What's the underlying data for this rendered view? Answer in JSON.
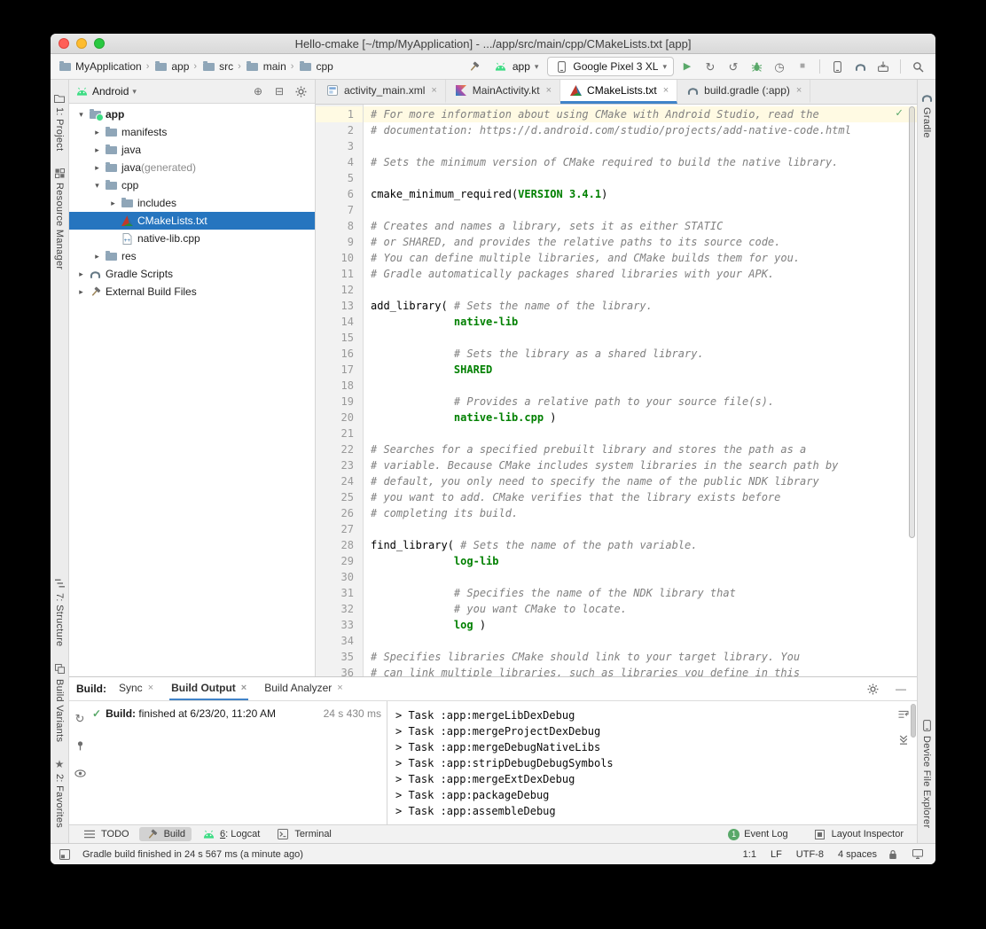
{
  "window": {
    "title": "Hello-cmake [~/tmp/MyApplication] - .../app/src/main/cpp/CMakeLists.txt [app]"
  },
  "colors": {
    "selection": "#2675bf",
    "keyword": "#008000",
    "comment": "#808080",
    "run_green": "#59a869",
    "caret_line": "#fffae3"
  },
  "toolbar": {
    "breadcrumbs": [
      "MyApplication",
      "app",
      "src",
      "main",
      "cpp"
    ],
    "run_config": {
      "label": "app"
    },
    "device_selector": {
      "label": "Google Pixel 3 XL"
    },
    "actions": [
      "run",
      "apply-changes",
      "apply-code-changes",
      "debug",
      "profile",
      "stop",
      "|",
      "device-manager",
      "sync-gradle",
      "sdk-manager",
      "|",
      "search"
    ]
  },
  "left_stripe": {
    "top": [
      {
        "label": "1: Project",
        "icon": "project-folder"
      },
      {
        "label": "Resource Manager",
        "icon": "resource-manager"
      }
    ],
    "bottom": [
      {
        "label": "7: Structure",
        "icon": "structure"
      },
      {
        "label": "Build Variants",
        "icon": "build-variants"
      },
      {
        "label": "2: Favorites",
        "icon": "favorites-star"
      }
    ]
  },
  "right_stripe": {
    "top": [
      {
        "label": "Gradle",
        "icon": "gradle"
      }
    ],
    "bottom": [
      {
        "label": "Device File Explorer",
        "icon": "device-phone"
      }
    ]
  },
  "project": {
    "view": "Android",
    "tree": [
      {
        "label": "app",
        "icon": "android-module",
        "arrow": "down",
        "level": 0,
        "bold": true
      },
      {
        "label": "manifests",
        "icon": "folder",
        "arrow": "right",
        "level": 1
      },
      {
        "label": "java",
        "icon": "folder",
        "arrow": "right",
        "level": 1
      },
      {
        "label": "java",
        "suffix": " (generated)",
        "icon": "folder",
        "arrow": "right",
        "level": 1
      },
      {
        "label": "cpp",
        "icon": "folder",
        "arrow": "down",
        "level": 1
      },
      {
        "label": "includes",
        "icon": "includes-folder",
        "arrow": "right",
        "level": 2
      },
      {
        "label": "CMakeLists.txt",
        "icon": "cmake-file",
        "level": 2,
        "selected": true
      },
      {
        "label": "native-lib.cpp",
        "icon": "cpp-file",
        "level": 2
      },
      {
        "label": "res",
        "icon": "folder",
        "arrow": "right",
        "level": 1
      },
      {
        "label": "Gradle Scripts",
        "icon": "gradle",
        "arrow": "right",
        "level": 0
      },
      {
        "label": "External Build Files",
        "icon": "build-file",
        "arrow": "right",
        "level": 0
      }
    ]
  },
  "tabs": [
    {
      "label": "activity_main.xml",
      "icon": "xml-layout"
    },
    {
      "label": "MainActivity.kt",
      "icon": "kotlin"
    },
    {
      "label": "CMakeLists.txt",
      "icon": "cmake-file",
      "active": true
    },
    {
      "label": "build.gradle (:app)",
      "icon": "gradle"
    }
  ],
  "editor": {
    "lines": [
      [
        [
          "# For more information about using CMake with Android Studio, read the",
          "c"
        ]
      ],
      [
        [
          "# documentation: https://d.android.com/studio/projects/add-native-code.html",
          "c"
        ]
      ],
      [],
      [
        [
          "# Sets the minimum version of CMake required to build the native library.",
          "c"
        ]
      ],
      [],
      [
        [
          "cmake_minimum_required(",
          "p"
        ],
        [
          "VERSION 3.4.1",
          "k"
        ],
        [
          ")",
          "p"
        ]
      ],
      [],
      [
        [
          "# Creates and names a library, sets it as either STATIC",
          "c"
        ]
      ],
      [
        [
          "# or SHARED, and provides the relative paths to its source code.",
          "c"
        ]
      ],
      [
        [
          "# You can define multiple libraries, and CMake builds them for you.",
          "c"
        ]
      ],
      [
        [
          "# Gradle automatically packages shared libraries with your APK.",
          "c"
        ]
      ],
      [],
      [
        [
          "add_library( ",
          "p"
        ],
        [
          "# Sets the name of the library.",
          "c"
        ]
      ],
      [
        [
          "             ",
          "p"
        ],
        [
          "native-lib",
          "k"
        ]
      ],
      [],
      [
        [
          "             ",
          "p"
        ],
        [
          "# Sets the library as a shared library.",
          "c"
        ]
      ],
      [
        [
          "             ",
          "p"
        ],
        [
          "SHARED",
          "k"
        ]
      ],
      [],
      [
        [
          "             ",
          "p"
        ],
        [
          "# Provides a relative path to your source file(s).",
          "c"
        ]
      ],
      [
        [
          "             ",
          "p"
        ],
        [
          "native-lib.cpp",
          "k"
        ],
        [
          " )",
          "p"
        ]
      ],
      [],
      [
        [
          "# Searches for a specified prebuilt library and stores the path as a",
          "c"
        ]
      ],
      [
        [
          "# variable. Because CMake includes system libraries in the search path by",
          "c"
        ]
      ],
      [
        [
          "# default, you only need to specify the name of the public NDK library",
          "c"
        ]
      ],
      [
        [
          "# you want to add. CMake verifies that the library exists before",
          "c"
        ]
      ],
      [
        [
          "# completing its build.",
          "c"
        ]
      ],
      [],
      [
        [
          "find_library( ",
          "p"
        ],
        [
          "# Sets the name of the path variable.",
          "c"
        ]
      ],
      [
        [
          "             ",
          "p"
        ],
        [
          "log-lib",
          "k"
        ]
      ],
      [],
      [
        [
          "             ",
          "p"
        ],
        [
          "# Specifies the name of the NDK library that",
          "c"
        ]
      ],
      [
        [
          "             ",
          "p"
        ],
        [
          "# you want CMake to locate.",
          "c"
        ]
      ],
      [
        [
          "             ",
          "p"
        ],
        [
          "log",
          "k"
        ],
        [
          " )",
          "p"
        ]
      ],
      [],
      [
        [
          "# Specifies libraries CMake should link to your target library. You",
          "c"
        ]
      ],
      [
        [
          "# can link multiple libraries, such as libraries you define in this",
          "c"
        ]
      ]
    ]
  },
  "build": {
    "label": "Build:",
    "tabs": [
      "Sync",
      "Build Output",
      "Build Analyzer"
    ],
    "active_tab": "Build Output",
    "side_icons": [
      "restart-build",
      "pin",
      "filter-eye"
    ],
    "status": {
      "prefix": "Build:",
      "text": " finished at 6/23/20, 11:20 AM",
      "duration": "24 s 430 ms"
    },
    "console": [
      "> Task :app:mergeLibDexDebug",
      "> Task :app:mergeProjectDexDebug",
      "> Task :app:mergeDebugNativeLibs",
      "> Task :app:stripDebugDebugSymbols",
      "> Task :app:mergeExtDexDebug",
      "> Task :app:packageDebug",
      "> Task :app:assembleDebug"
    ],
    "console_icons": [
      "soft-wrap",
      "scroll-to-end"
    ]
  },
  "bottom_bar": {
    "left": [
      {
        "label": "TODO",
        "icon": "todo"
      },
      {
        "label": "Build",
        "icon": "hammer",
        "active": true
      },
      {
        "label": "6: Logcat",
        "icon": "android-head",
        "mnemonic": true
      },
      {
        "label": "Terminal",
        "icon": "terminal"
      }
    ],
    "right": [
      {
        "label": "Event Log",
        "badge": "1"
      },
      {
        "label": "Layout Inspector",
        "icon": "layout-inspector"
      }
    ]
  },
  "status_bar": {
    "message": "Gradle build finished in 24 s 567 ms (a minute ago)",
    "indicators": [
      "1:1",
      "LF",
      "UTF-8",
      "4 spaces"
    ]
  }
}
